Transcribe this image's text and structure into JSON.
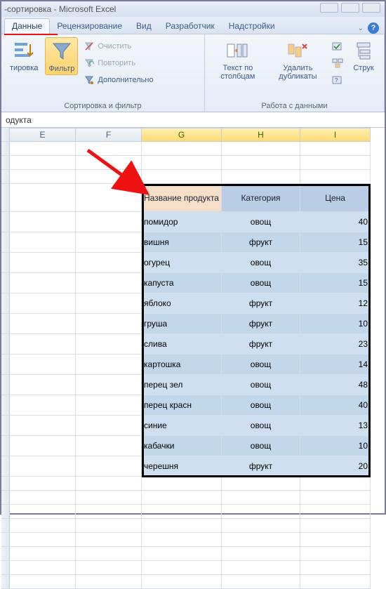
{
  "window": {
    "title": "-сортировка - Microsoft Excel"
  },
  "tabs": {
    "items": [
      "Данные",
      "Рецензирование",
      "Вид",
      "Разработчик",
      "Надстройки"
    ],
    "active": 0
  },
  "ribbon": {
    "sort_filter": {
      "label": "Сортировка и фильтр",
      "sort_btn": "тировка",
      "filter_btn": "Фильтр",
      "clear": "Очистить",
      "reapply": "Повторить",
      "advanced": "Дополнительно"
    },
    "data_tools": {
      "label": "Работа с данными",
      "text_to_cols": "Текст по столбцам",
      "remove_dupes": "Удалить дубликаты",
      "struct": "Струк"
    }
  },
  "formula_bar": "одукта",
  "columns": [
    "E",
    "F",
    "G",
    "H",
    "I"
  ],
  "table": {
    "headers": [
      "Название продукта",
      "Категория",
      "Цена"
    ],
    "rows": [
      {
        "name": "помидор",
        "cat": "овощ",
        "price": 40
      },
      {
        "name": "вишня",
        "cat": "фрукт",
        "price": 15
      },
      {
        "name": "огурец",
        "cat": "овощ",
        "price": 35
      },
      {
        "name": "капуста",
        "cat": "овощ",
        "price": 15
      },
      {
        "name": "яблоко",
        "cat": "фрукт",
        "price": 12
      },
      {
        "name": "груша",
        "cat": "фрукт",
        "price": 10
      },
      {
        "name": "слива",
        "cat": "фрукт",
        "price": 23
      },
      {
        "name": "картошка",
        "cat": "овощ",
        "price": 14
      },
      {
        "name": "перец зел",
        "cat": "овощ",
        "price": 48
      },
      {
        "name": "перец красн",
        "cat": "овощ",
        "price": 40
      },
      {
        "name": "синие",
        "cat": "овощ",
        "price": 13
      },
      {
        "name": "кабачки",
        "cat": "овощ",
        "price": 10
      },
      {
        "name": "черешня",
        "cat": "фрукт",
        "price": 20
      }
    ]
  }
}
